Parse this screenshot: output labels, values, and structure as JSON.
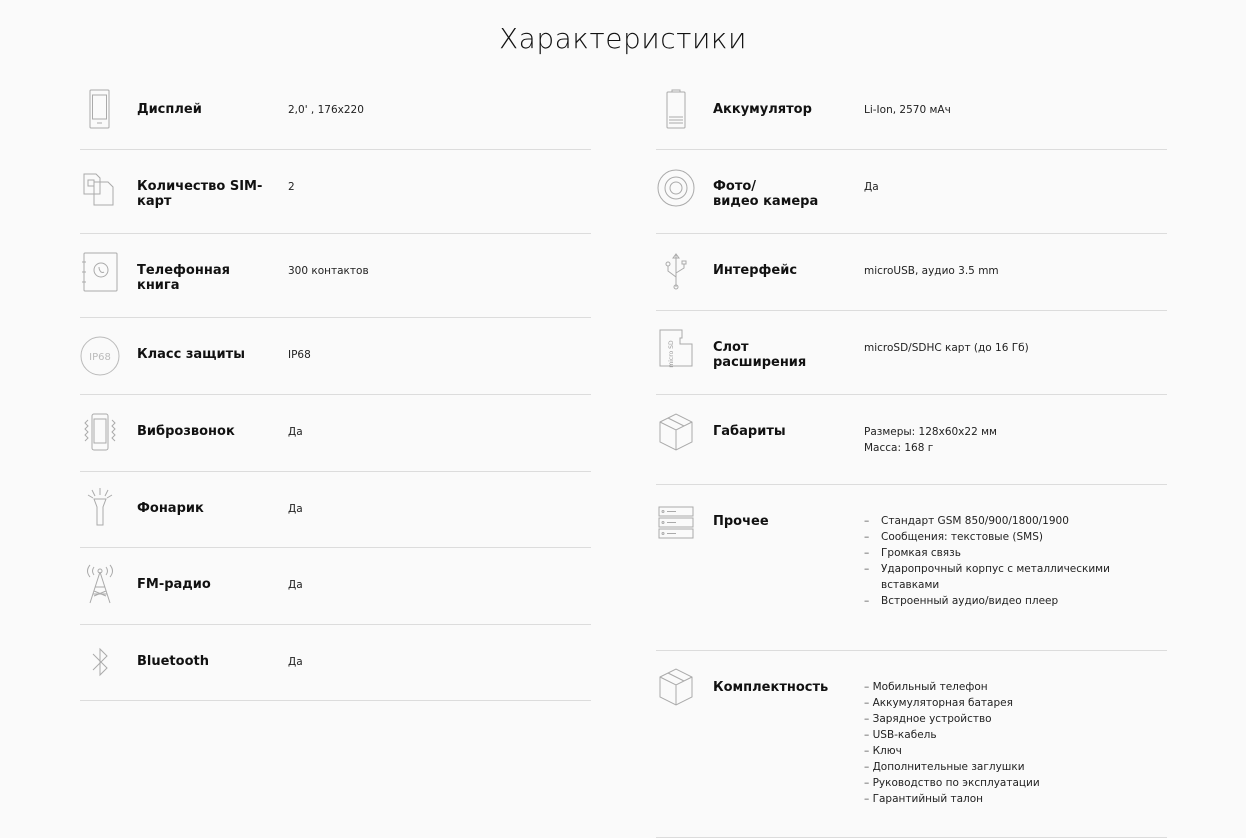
{
  "title": "Характеристики",
  "left": [
    {
      "icon": "phone-display-icon",
      "label": "Дисплей",
      "value": "2,0' , 176x220"
    },
    {
      "icon": "sim-cards-icon",
      "label": "Количество SIM-\nкарт",
      "value": "2"
    },
    {
      "icon": "phonebook-icon",
      "label": "Телефонная\nкнига",
      "value": "300 контактов"
    },
    {
      "icon": "ip68-icon",
      "icon_text": "IP68",
      "label": "Класс защиты",
      "value": "IP68"
    },
    {
      "icon": "vibration-icon",
      "label": "Виброзвонок",
      "value": "Да"
    },
    {
      "icon": "flashlight-icon",
      "label": "Фонарик",
      "value": "Да"
    },
    {
      "icon": "radio-tower-icon",
      "label": "FM-радио",
      "value": "Да"
    },
    {
      "icon": "bluetooth-icon",
      "label": "Bluetooth",
      "value": "Да"
    }
  ],
  "right": [
    {
      "icon": "battery-icon",
      "label": "Аккумулятор",
      "value": "Li-Ion, 2570 мАч"
    },
    {
      "icon": "camera-icon",
      "label": "Фото/\nвидео камера",
      "value": "Да"
    },
    {
      "icon": "usb-icon",
      "label": "Интерфейс",
      "value": "microUSB, аудио 3.5 mm"
    },
    {
      "icon": "microsd-card-icon",
      "icon_text": "micro SD",
      "label": "Слот\nрасширения",
      "value": "microSD/SDHC карт (до 16 Гб)"
    },
    {
      "icon": "box-icon",
      "label": "Габариты",
      "value_lines": [
        "Размеры: 128x60x22 мм",
        "Масса: 168 г"
      ]
    },
    {
      "icon": "server-icon",
      "label": "Прочее",
      "items": [
        "Стандарт GSM 850/900/1800/1900",
        "Сообщения: текстовые (SMS)",
        "Громкая связь",
        "Ударопрочный корпус с металлическими вставками",
        "Встроенный аудио/видео плеер"
      ]
    },
    {
      "icon": "package-icon",
      "label": "Комплектность",
      "items": [
        "Мобильный телефон",
        "Аккумуляторная батарея",
        "Зарядное устройство",
        "USB-кабель",
        "Ключ",
        "Дополнительные заглушки",
        "Руководство по эксплуатации",
        "Гарантийный талон"
      ]
    }
  ]
}
